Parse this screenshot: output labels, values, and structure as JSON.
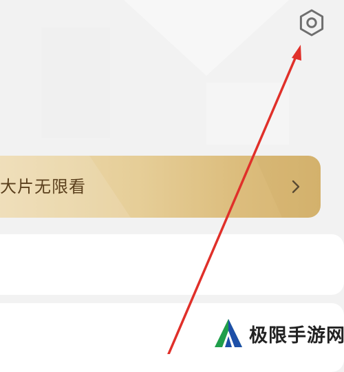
{
  "header": {
    "settings_icon": "gear-hexagon-icon"
  },
  "vip_banner": {
    "text": "大片无限看",
    "chevron_icon": "chevron-right-icon"
  },
  "annotation": {
    "arrow_color": "#e0302a"
  },
  "watermark": {
    "text": "极限手游网",
    "logo_icon": "green-blue-shield-logo"
  },
  "colors": {
    "background": "#f2f2f2",
    "banner_gold": "#e6ce98",
    "banner_text": "#5a3f1c",
    "card": "#ffffff"
  }
}
